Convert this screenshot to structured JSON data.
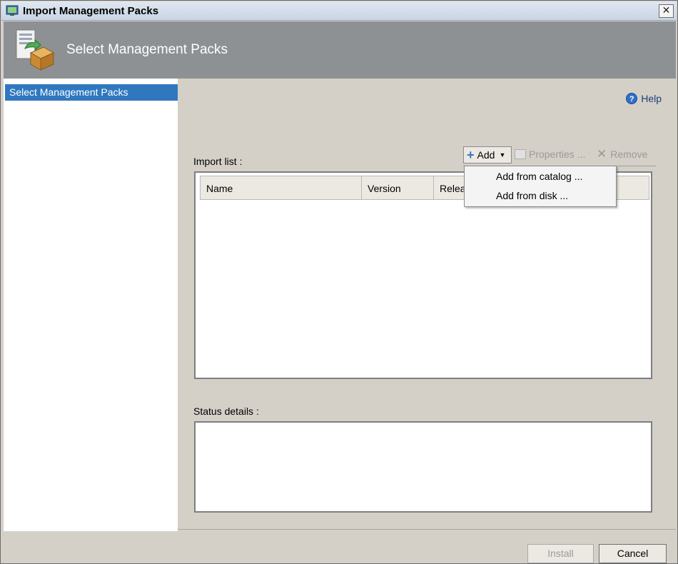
{
  "window": {
    "title": "Import Management Packs",
    "close_glyph": "✕"
  },
  "banner": {
    "title": "Select Management Packs",
    "icon": "management-pack-icon"
  },
  "nav": {
    "items": [
      {
        "label": "Select Management Packs",
        "selected": true
      }
    ]
  },
  "help": {
    "label": "Help",
    "icon_glyph": "?"
  },
  "import_list": {
    "label": "Import list :",
    "columns": [
      "Name",
      "Version",
      "Relea"
    ]
  },
  "toolbar": {
    "add_label": "Add",
    "properties_label": "Properties ...",
    "remove_label": "Remove"
  },
  "add_menu": {
    "items": [
      "Add from catalog ...",
      "Add from disk ..."
    ]
  },
  "status": {
    "label": "Status details :"
  },
  "buttons": {
    "install": "Install",
    "cancel": "Cancel"
  },
  "colors": {
    "accent": "#2f78bf",
    "banner": "#8e9193",
    "dialog_bg": "#d4d0c8"
  }
}
